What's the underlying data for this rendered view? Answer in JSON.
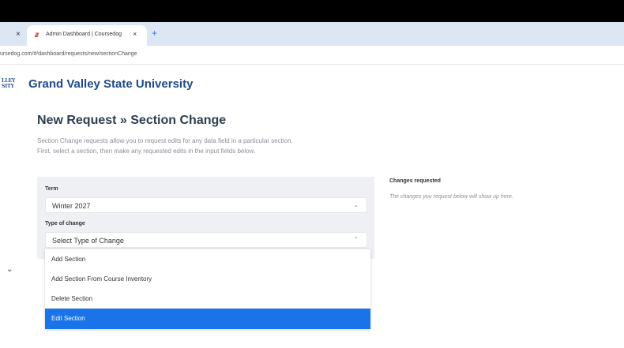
{
  "browser": {
    "tab_title": "Admin Dashboard | Coursedog",
    "url": "ursedog.com/#/dashboard/requests/new/sectionChange"
  },
  "brand": {
    "logo_text": "LLEY\nSITY",
    "name": "Grand Valley State University"
  },
  "page": {
    "title": "New Request » Section Change",
    "description": "Section Change requests allow you to request edits for any data field in a particular section. First, select a section, then make any requested edits in the input fields below."
  },
  "form": {
    "term_label": "Term",
    "term_value": "Winter 2027",
    "change_label": "Type of change",
    "change_placeholder": "Select Type of Change"
  },
  "dropdown": {
    "options": [
      {
        "label": "Add Section"
      },
      {
        "label": "Add Section From Course Inventory"
      },
      {
        "label": "Delete Section"
      },
      {
        "label": "Edit Section"
      }
    ],
    "highlighted_index": 3,
    "highlight_color": "#1a73e8"
  },
  "changes": {
    "title": "Changes requested",
    "text": "The changes you request below will show up here."
  },
  "icons": {
    "close": "×",
    "new_tab": "+",
    "caret": "⌃",
    "chevron_down": "⌄",
    "favicon": "ƶ"
  }
}
